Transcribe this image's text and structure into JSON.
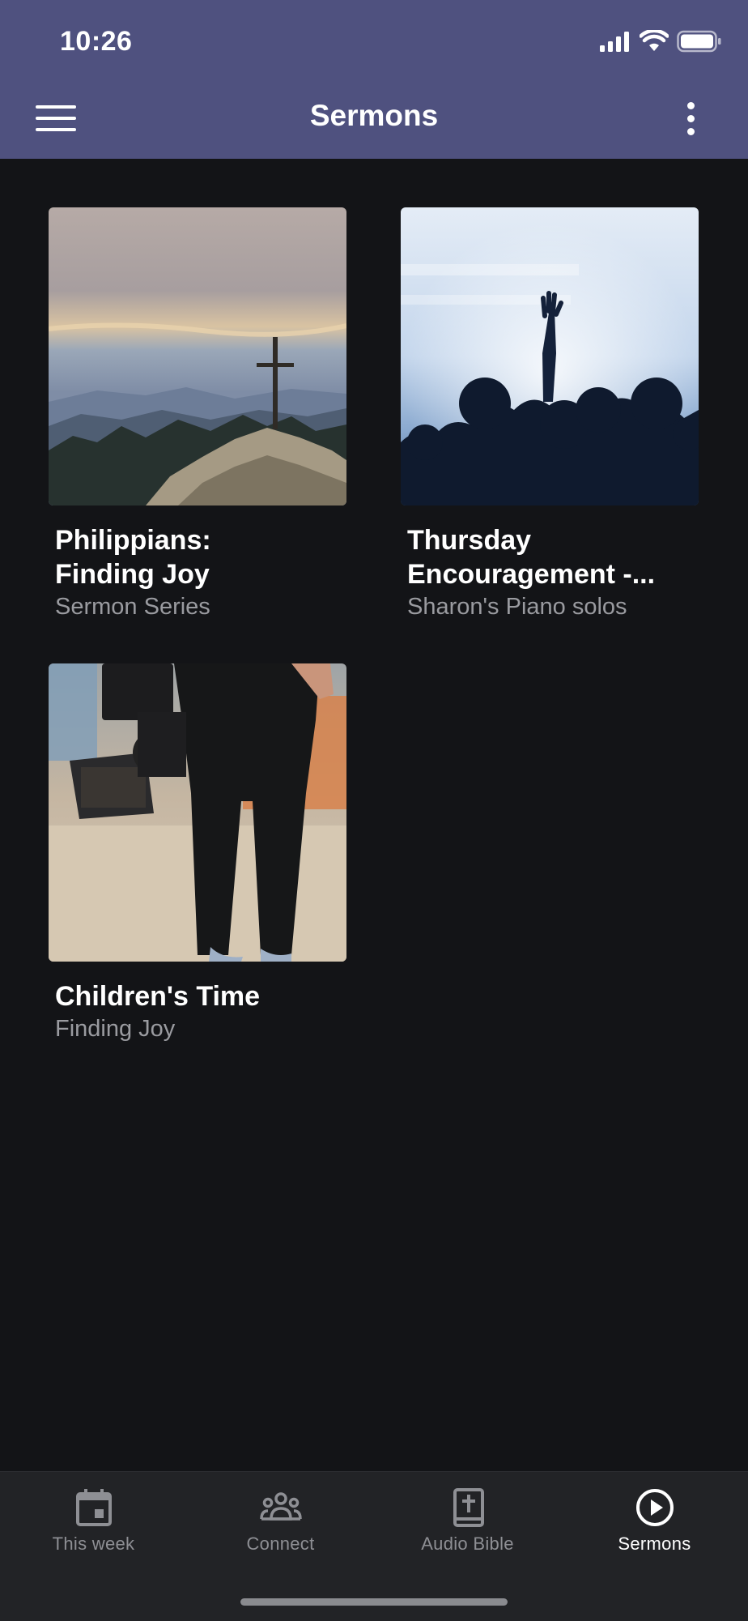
{
  "status_bar": {
    "time": "10:26"
  },
  "header": {
    "title": "Sermons"
  },
  "cards": [
    {
      "title": "Philippians:\nFinding Joy",
      "subtitle": "Sermon Series",
      "image": "mountain-cross-photo"
    },
    {
      "title": "Thursday\nEncouragement -...",
      "subtitle": "Sharon's Piano solos",
      "image": "worship-crowd-photo"
    },
    {
      "title": "Children's Time",
      "subtitle": "Finding Joy",
      "image": "camera-operator-photo"
    }
  ],
  "bottom_nav": {
    "items": [
      {
        "label": "This week",
        "icon": "calendar-icon",
        "active": false
      },
      {
        "label": "Connect",
        "icon": "group-icon",
        "active": false
      },
      {
        "label": "Audio Bible",
        "icon": "bible-icon",
        "active": false
      },
      {
        "label": "Sermons",
        "icon": "play-circle-icon",
        "active": true
      }
    ]
  },
  "colors": {
    "appbar": "#4f517f",
    "background": "#131417",
    "nav_background": "#222326",
    "nav_inactive": "#8e8f94",
    "nav_active": "#ffffff"
  }
}
